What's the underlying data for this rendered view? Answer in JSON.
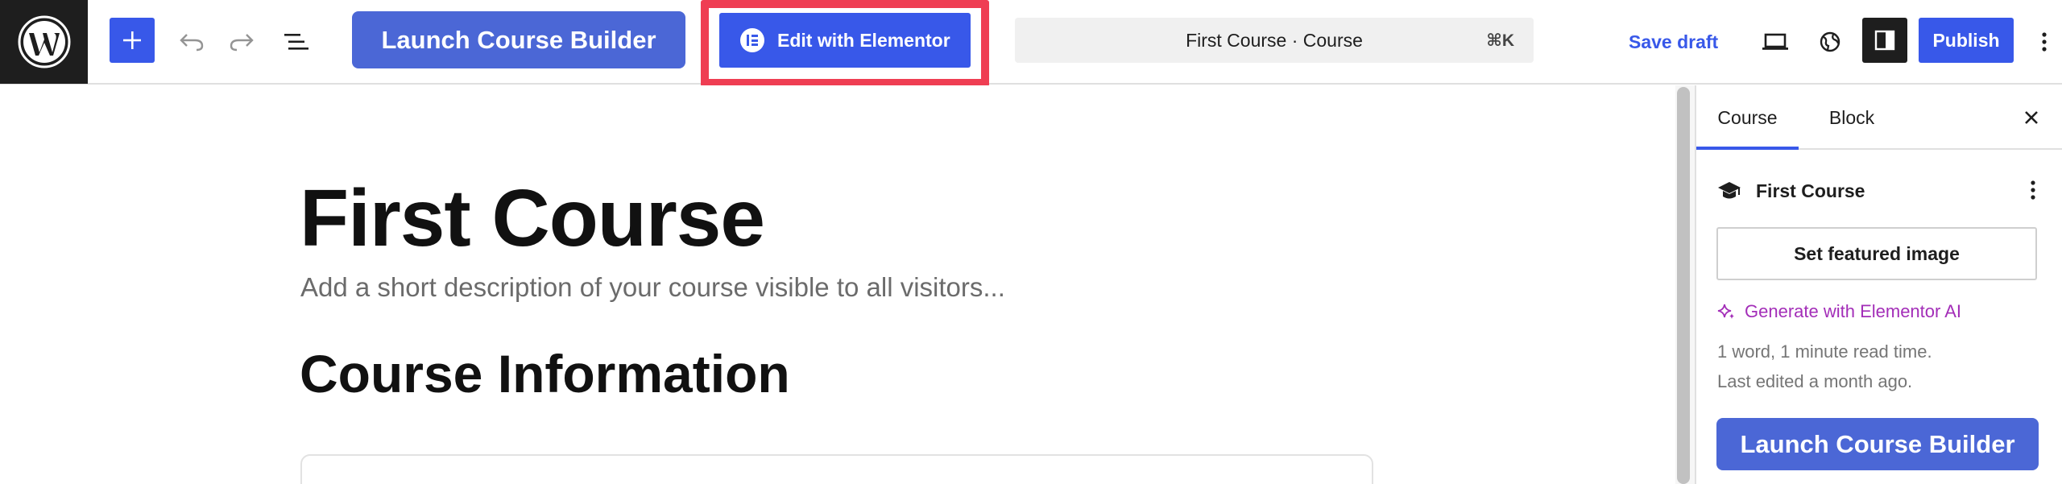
{
  "toolbar": {
    "launch_builder_label": "Launch Course Builder",
    "edit_elementor_label": "Edit with Elementor",
    "command_bar_title": "First Course · Course",
    "command_shortcut": "⌘K",
    "save_draft_label": "Save draft",
    "publish_label": "Publish",
    "icons": [
      "wordpress-logo-icon",
      "plus-icon",
      "undo-icon",
      "redo-icon",
      "list-view-icon",
      "desktop-preview-icon",
      "globe-icon",
      "sidebar-icon",
      "more-vertical-icon"
    ]
  },
  "editor": {
    "title": "First Course",
    "excerpt_placeholder": "Add a short description of your course visible to all visitors...",
    "section_heading": "Course Information"
  },
  "sidebar": {
    "tabs": [
      {
        "label": "Course",
        "active": true
      },
      {
        "label": "Block",
        "active": false
      }
    ],
    "document_title": "First Course",
    "featured_image_label": "Set featured image",
    "generate_ai_label": "Generate with Elementor AI",
    "word_count_text": "1 word, 1 minute read time.",
    "last_edited_text": "Last edited a month ago.",
    "launch_builder_label": "Launch Course Builder"
  },
  "colors": {
    "accent": "#3858e9",
    "builder_button": "#4b67d6",
    "highlight": "#ef3e53",
    "ai_purple": "#a32eb8",
    "dark": "#1e1e1e"
  }
}
